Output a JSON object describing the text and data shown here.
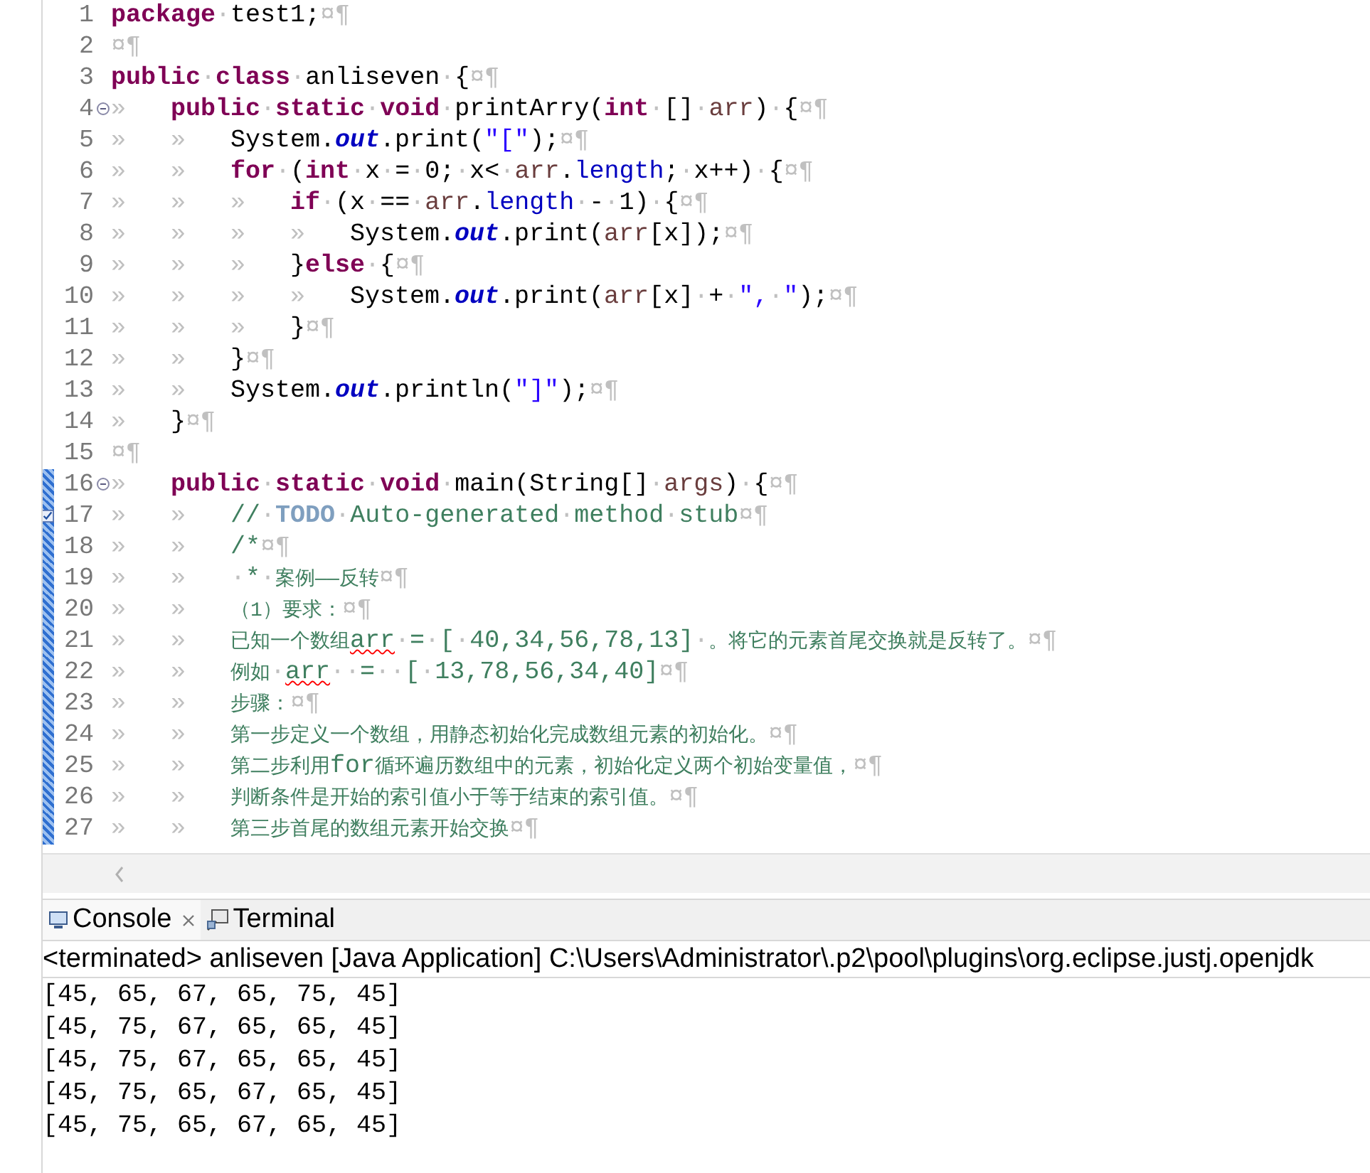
{
  "editor": {
    "lines": [
      {
        "number": "1",
        "in_range": false,
        "tokens": [
          {
            "kind": "k",
            "text": "package"
          },
          {
            "kind": "w",
            "text": "·"
          },
          {
            "kind": "p",
            "text": "test1;"
          },
          {
            "kind": "w",
            "text": "¤¶"
          }
        ]
      },
      {
        "number": "2",
        "in_range": false,
        "tokens": [
          {
            "kind": "w",
            "text": "¤¶"
          }
        ]
      },
      {
        "number": "3",
        "in_range": false,
        "tokens": [
          {
            "kind": "k",
            "text": "public"
          },
          {
            "kind": "w",
            "text": "·"
          },
          {
            "kind": "k",
            "text": "class"
          },
          {
            "kind": "w",
            "text": "·"
          },
          {
            "kind": "p",
            "text": "anliseven"
          },
          {
            "kind": "w",
            "text": "·"
          },
          {
            "kind": "p",
            "text": "{"
          },
          {
            "kind": "w",
            "text": "¤¶"
          }
        ]
      },
      {
        "number": "4",
        "in_range": false,
        "gutter_icon": {
          "kind": "fold"
        },
        "tokens": [
          {
            "kind": "tab",
            "text": "»"
          },
          {
            "kind": "k",
            "text": "public"
          },
          {
            "kind": "w",
            "text": "·"
          },
          {
            "kind": "k",
            "text": "static"
          },
          {
            "kind": "w",
            "text": "·"
          },
          {
            "kind": "k",
            "text": "void"
          },
          {
            "kind": "w",
            "text": "·"
          },
          {
            "kind": "p",
            "text": "printArry("
          },
          {
            "kind": "k",
            "text": "int"
          },
          {
            "kind": "w",
            "text": "·"
          },
          {
            "kind": "p",
            "text": "[]"
          },
          {
            "kind": "w",
            "text": "·"
          },
          {
            "kind": "v",
            "text": "arr"
          },
          {
            "kind": "p",
            "text": ")"
          },
          {
            "kind": "w",
            "text": "·"
          },
          {
            "kind": "p",
            "text": "{"
          },
          {
            "kind": "w",
            "text": "¤¶"
          }
        ]
      },
      {
        "number": "5",
        "in_range": false,
        "tokens": [
          {
            "kind": "tab",
            "text": "»"
          },
          {
            "kind": "tab",
            "text": "»"
          },
          {
            "kind": "p",
            "text": "System."
          },
          {
            "kind": "f",
            "text": "out"
          },
          {
            "kind": "p",
            "text": ".print("
          },
          {
            "kind": "s",
            "text": "\"[\""
          },
          {
            "kind": "p",
            "text": ");"
          },
          {
            "kind": "w",
            "text": "¤¶"
          }
        ]
      },
      {
        "number": "6",
        "in_range": false,
        "tokens": [
          {
            "kind": "tab",
            "text": "»"
          },
          {
            "kind": "tab",
            "text": "»"
          },
          {
            "kind": "k",
            "text": "for"
          },
          {
            "kind": "w",
            "text": "·"
          },
          {
            "kind": "p",
            "text": "("
          },
          {
            "kind": "k",
            "text": "int"
          },
          {
            "kind": "w",
            "text": "·"
          },
          {
            "kind": "p",
            "text": "x"
          },
          {
            "kind": "w",
            "text": "·"
          },
          {
            "kind": "p",
            "text": "="
          },
          {
            "kind": "w",
            "text": "·"
          },
          {
            "kind": "p",
            "text": "0;"
          },
          {
            "kind": "w",
            "text": "·"
          },
          {
            "kind": "p",
            "text": "x<"
          },
          {
            "kind": "w",
            "text": "·"
          },
          {
            "kind": "v",
            "text": "arr"
          },
          {
            "kind": "p",
            "text": "."
          },
          {
            "kind": "m",
            "text": "length"
          },
          {
            "kind": "p",
            "text": ";"
          },
          {
            "kind": "w",
            "text": "·"
          },
          {
            "kind": "p",
            "text": "x++)"
          },
          {
            "kind": "w",
            "text": "·"
          },
          {
            "kind": "p",
            "text": "{"
          },
          {
            "kind": "w",
            "text": "¤¶"
          }
        ]
      },
      {
        "number": "7",
        "in_range": false,
        "tokens": [
          {
            "kind": "tab",
            "text": "»"
          },
          {
            "kind": "tab",
            "text": "»"
          },
          {
            "kind": "tab",
            "text": "»"
          },
          {
            "kind": "k",
            "text": "if"
          },
          {
            "kind": "w",
            "text": "·"
          },
          {
            "kind": "p",
            "text": "(x"
          },
          {
            "kind": "w",
            "text": "·"
          },
          {
            "kind": "p",
            "text": "=="
          },
          {
            "kind": "w",
            "text": "·"
          },
          {
            "kind": "v",
            "text": "arr"
          },
          {
            "kind": "p",
            "text": "."
          },
          {
            "kind": "m",
            "text": "length"
          },
          {
            "kind": "w",
            "text": "·"
          },
          {
            "kind": "p",
            "text": "-"
          },
          {
            "kind": "w",
            "text": "·"
          },
          {
            "kind": "p",
            "text": "1)"
          },
          {
            "kind": "w",
            "text": "·"
          },
          {
            "kind": "p",
            "text": "{"
          },
          {
            "kind": "w",
            "text": "¤¶"
          }
        ]
      },
      {
        "number": "8",
        "in_range": false,
        "tokens": [
          {
            "kind": "tab",
            "text": "»"
          },
          {
            "kind": "tab",
            "text": "»"
          },
          {
            "kind": "tab",
            "text": "»"
          },
          {
            "kind": "tab",
            "text": "»"
          },
          {
            "kind": "p",
            "text": "System."
          },
          {
            "kind": "f",
            "text": "out"
          },
          {
            "kind": "p",
            "text": ".print("
          },
          {
            "kind": "v",
            "text": "arr"
          },
          {
            "kind": "p",
            "text": "[x]);"
          },
          {
            "kind": "w",
            "text": "¤¶"
          }
        ]
      },
      {
        "number": "9",
        "in_range": false,
        "tokens": [
          {
            "kind": "tab",
            "text": "»"
          },
          {
            "kind": "tab",
            "text": "»"
          },
          {
            "kind": "tab",
            "text": "»"
          },
          {
            "kind": "p",
            "text": "}"
          },
          {
            "kind": "k",
            "text": "else"
          },
          {
            "kind": "w",
            "text": "·"
          },
          {
            "kind": "p",
            "text": "{"
          },
          {
            "kind": "w",
            "text": "¤¶"
          }
        ]
      },
      {
        "number": "10",
        "in_range": false,
        "tokens": [
          {
            "kind": "tab",
            "text": "»"
          },
          {
            "kind": "tab",
            "text": "»"
          },
          {
            "kind": "tab",
            "text": "»"
          },
          {
            "kind": "tab",
            "text": "»"
          },
          {
            "kind": "p",
            "text": "System."
          },
          {
            "kind": "f",
            "text": "out"
          },
          {
            "kind": "p",
            "text": ".print("
          },
          {
            "kind": "v",
            "text": "arr"
          },
          {
            "kind": "p",
            "text": "[x]"
          },
          {
            "kind": "w",
            "text": "·"
          },
          {
            "kind": "p",
            "text": "+"
          },
          {
            "kind": "w",
            "text": "·"
          },
          {
            "kind": "s",
            "text": "\","
          },
          {
            "kind": "w",
            "text": "·"
          },
          {
            "kind": "s",
            "text": "\""
          },
          {
            "kind": "p",
            "text": ");"
          },
          {
            "kind": "w",
            "text": "¤¶"
          }
        ]
      },
      {
        "number": "11",
        "in_range": false,
        "tokens": [
          {
            "kind": "tab",
            "text": "»"
          },
          {
            "kind": "tab",
            "text": "»"
          },
          {
            "kind": "tab",
            "text": "»"
          },
          {
            "kind": "p",
            "text": "}"
          },
          {
            "kind": "w",
            "text": "¤¶"
          }
        ]
      },
      {
        "number": "12",
        "in_range": false,
        "tokens": [
          {
            "kind": "tab",
            "text": "»"
          },
          {
            "kind": "tab",
            "text": "»"
          },
          {
            "kind": "p",
            "text": "}"
          },
          {
            "kind": "w",
            "text": "¤¶"
          }
        ]
      },
      {
        "number": "13",
        "in_range": false,
        "tokens": [
          {
            "kind": "tab",
            "text": "»"
          },
          {
            "kind": "tab",
            "text": "»"
          },
          {
            "kind": "p",
            "text": "System."
          },
          {
            "kind": "f",
            "text": "out"
          },
          {
            "kind": "p",
            "text": ".println("
          },
          {
            "kind": "s",
            "text": "\"]\""
          },
          {
            "kind": "p",
            "text": ");"
          },
          {
            "kind": "w",
            "text": "¤¶"
          }
        ]
      },
      {
        "number": "14",
        "in_range": false,
        "tokens": [
          {
            "kind": "tab",
            "text": "»"
          },
          {
            "kind": "p",
            "text": "}"
          },
          {
            "kind": "w",
            "text": "¤¶"
          }
        ]
      },
      {
        "number": "15",
        "in_range": false,
        "tokens": [
          {
            "kind": "w",
            "text": "¤¶"
          }
        ]
      },
      {
        "number": "16",
        "in_range": true,
        "gutter_icon": {
          "kind": "fold"
        },
        "tokens": [
          {
            "kind": "tab",
            "text": "»"
          },
          {
            "kind": "k",
            "text": "public"
          },
          {
            "kind": "w",
            "text": "·"
          },
          {
            "kind": "k",
            "text": "static"
          },
          {
            "kind": "w",
            "text": "·"
          },
          {
            "kind": "k",
            "text": "void"
          },
          {
            "kind": "w",
            "text": "·"
          },
          {
            "kind": "p",
            "text": "main(String[]"
          },
          {
            "kind": "w",
            "text": "·"
          },
          {
            "kind": "v",
            "text": "args"
          },
          {
            "kind": "p",
            "text": ")"
          },
          {
            "kind": "w",
            "text": "·"
          },
          {
            "kind": "p",
            "text": "{"
          },
          {
            "kind": "w",
            "text": "¤¶"
          }
        ]
      },
      {
        "number": "17",
        "in_range": true,
        "gutter_icon": {
          "kind": "task"
        },
        "tokens": [
          {
            "kind": "tab",
            "text": "»"
          },
          {
            "kind": "tab",
            "text": "»"
          },
          {
            "kind": "c",
            "text": "//"
          },
          {
            "kind": "w",
            "text": "·"
          },
          {
            "kind": "todo",
            "text": "TODO"
          },
          {
            "kind": "w",
            "text": "·"
          },
          {
            "kind": "c",
            "text": "Auto-generated"
          },
          {
            "kind": "w",
            "text": "·"
          },
          {
            "kind": "c",
            "text": "method"
          },
          {
            "kind": "w",
            "text": "·"
          },
          {
            "kind": "c",
            "text": "stub"
          },
          {
            "kind": "w",
            "text": "¤¶"
          }
        ]
      },
      {
        "number": "18",
        "in_range": true,
        "tokens": [
          {
            "kind": "tab",
            "text": "»"
          },
          {
            "kind": "tab",
            "text": "»"
          },
          {
            "kind": "c",
            "text": "/*"
          },
          {
            "kind": "w",
            "text": "¤¶"
          }
        ]
      },
      {
        "number": "19",
        "in_range": true,
        "tokens": [
          {
            "kind": "tab",
            "text": "»"
          },
          {
            "kind": "tab",
            "text": "»"
          },
          {
            "kind": "w",
            "text": "·"
          },
          {
            "kind": "c",
            "text": "*"
          },
          {
            "kind": "w",
            "text": "·"
          },
          {
            "kind": "z",
            "text": "案例——反转"
          },
          {
            "kind": "w",
            "text": "¤¶"
          }
        ]
      },
      {
        "number": "20",
        "in_range": true,
        "tokens": [
          {
            "kind": "tab",
            "text": "»"
          },
          {
            "kind": "tab",
            "text": "»"
          },
          {
            "kind": "z",
            "text": "（1）要求："
          },
          {
            "kind": "w",
            "text": "¤¶"
          }
        ]
      },
      {
        "number": "21",
        "in_range": true,
        "tokens": [
          {
            "kind": "tab",
            "text": "»"
          },
          {
            "kind": "tab",
            "text": "»"
          },
          {
            "kind": "z",
            "text": "已知一个数组"
          },
          {
            "kind": "u",
            "text": "arr"
          },
          {
            "kind": "w",
            "text": "·"
          },
          {
            "kind": "c",
            "text": "="
          },
          {
            "kind": "w",
            "text": "·"
          },
          {
            "kind": "c",
            "text": "["
          },
          {
            "kind": "w",
            "text": "·"
          },
          {
            "kind": "c",
            "text": "40,34,56,78,13]"
          },
          {
            "kind": "w",
            "text": "·"
          },
          {
            "kind": "z",
            "text": "。将它的元素首尾交换就是反转了。"
          },
          {
            "kind": "w",
            "text": "¤¶"
          }
        ]
      },
      {
        "number": "22",
        "in_range": true,
        "tokens": [
          {
            "kind": "tab",
            "text": "»"
          },
          {
            "kind": "tab",
            "text": "»"
          },
          {
            "kind": "z",
            "text": "例如"
          },
          {
            "kind": "w",
            "text": "·"
          },
          {
            "kind": "u",
            "text": "arr"
          },
          {
            "kind": "w",
            "text": "··"
          },
          {
            "kind": "c",
            "text": "="
          },
          {
            "kind": "w",
            "text": "··"
          },
          {
            "kind": "c",
            "text": "["
          },
          {
            "kind": "w",
            "text": "·"
          },
          {
            "kind": "c",
            "text": "13,78,56,34,40]"
          },
          {
            "kind": "w",
            "text": "¤¶"
          }
        ]
      },
      {
        "number": "23",
        "in_range": true,
        "tokens": [
          {
            "kind": "tab",
            "text": "»"
          },
          {
            "kind": "tab",
            "text": "»"
          },
          {
            "kind": "z",
            "text": "步骤："
          },
          {
            "kind": "w",
            "text": "¤¶"
          }
        ]
      },
      {
        "number": "24",
        "in_range": true,
        "tokens": [
          {
            "kind": "tab",
            "text": "»"
          },
          {
            "kind": "tab",
            "text": "»"
          },
          {
            "kind": "z",
            "text": "第一步定义一个数组，用静态初始化完成数组元素的初始化。"
          },
          {
            "kind": "w",
            "text": "¤¶"
          }
        ]
      },
      {
        "number": "25",
        "in_range": true,
        "tokens": [
          {
            "kind": "tab",
            "text": "»"
          },
          {
            "kind": "tab",
            "text": "»"
          },
          {
            "kind": "z",
            "text": "第二步利用"
          },
          {
            "kind": "c",
            "text": "for"
          },
          {
            "kind": "z",
            "text": "循环遍历数组中的元素，初始化定义两个初始变量值，"
          },
          {
            "kind": "w",
            "text": "¤¶"
          }
        ]
      },
      {
        "number": "26",
        "in_range": true,
        "tokens": [
          {
            "kind": "tab",
            "text": "»"
          },
          {
            "kind": "tab",
            "text": "»"
          },
          {
            "kind": "z",
            "text": "判断条件是开始的索引值小于等于结束的索引值。"
          },
          {
            "kind": "w",
            "text": "¤¶"
          }
        ]
      },
      {
        "number": "27",
        "in_range": true,
        "tokens": [
          {
            "kind": "tab",
            "text": "»"
          },
          {
            "kind": "tab",
            "text": "»"
          },
          {
            "kind": "z",
            "text": "第三步首尾的数组元素开始交换"
          },
          {
            "kind": "w",
            "text": "¤¶"
          }
        ]
      }
    ]
  },
  "console": {
    "tabs": [
      {
        "label": "Console",
        "kind": "console",
        "selected": true
      },
      {
        "label": "Terminal",
        "kind": "terminal",
        "selected": false
      }
    ],
    "description": "<terminated> anliseven [Java Application] C:\\Users\\Administrator\\.p2\\pool\\plugins\\org.eclipse.justj.openjdk",
    "output": [
      "[45, 65, 67, 65, 75, 45]",
      "[45, 75, 67, 65, 65, 45]",
      "[45, 75, 67, 65, 65, 45]",
      "[45, 75, 65, 67, 65, 45]",
      "[45, 75, 65, 67, 65, 45]"
    ]
  }
}
